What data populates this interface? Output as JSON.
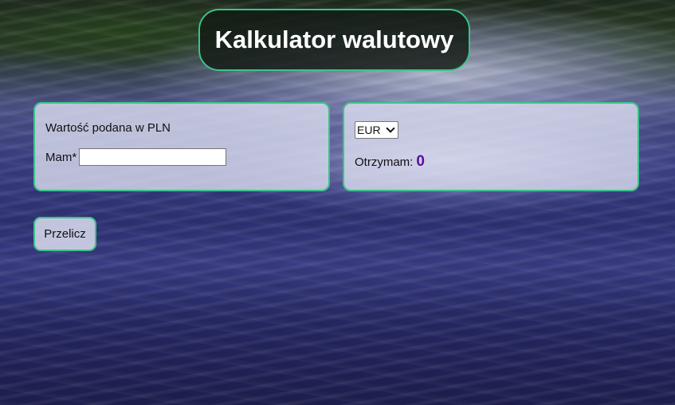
{
  "header": {
    "title": "Kalkulator walutowy"
  },
  "input_panel": {
    "label": "Wartość podana w PLN",
    "field_label": "Mam*",
    "field_value": ""
  },
  "output_panel": {
    "currency_selected": "EUR",
    "result_label": "Otrzymam:",
    "result_value": "0"
  },
  "actions": {
    "calculate_label": "Przelicz"
  },
  "colors": {
    "accent_border": "#3cc38a",
    "result_text": "#5b0f9c",
    "title_bg": "#121a14"
  }
}
